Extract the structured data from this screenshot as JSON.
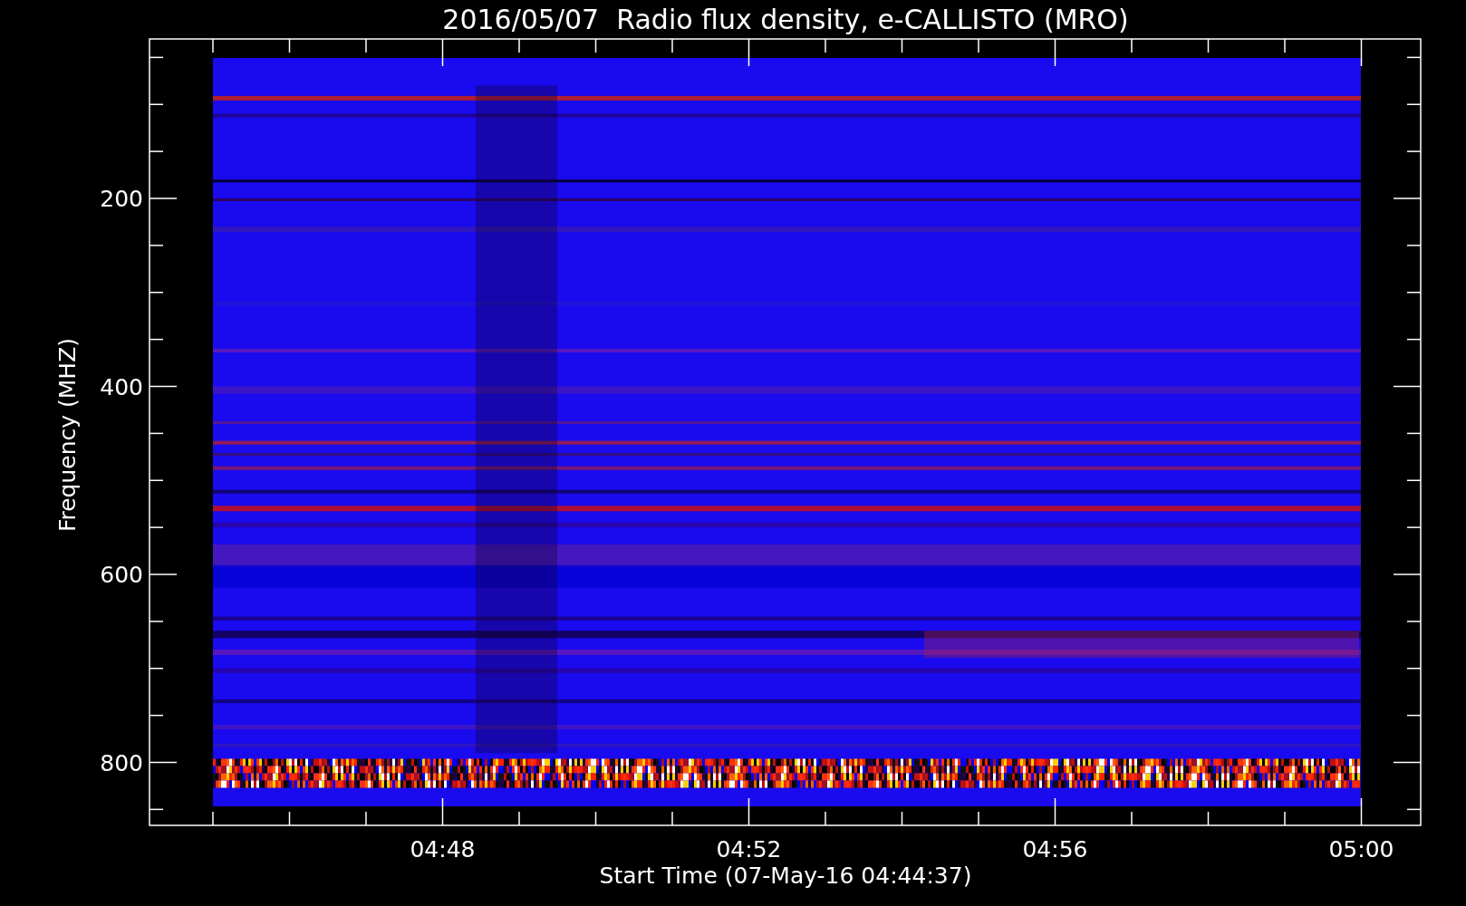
{
  "chart": {
    "title": "2016/05/07  Radio flux density, e-CALLISTO (MRO)",
    "ylabel": "Frequency (MHZ)",
    "xlabel": "Start Time (07-May-16 04:44:37)",
    "yticks": [
      "200",
      "400",
      "600",
      "800"
    ],
    "xticks": [
      "04:48",
      "04:52",
      "04:56",
      "05:00"
    ]
  }
}
